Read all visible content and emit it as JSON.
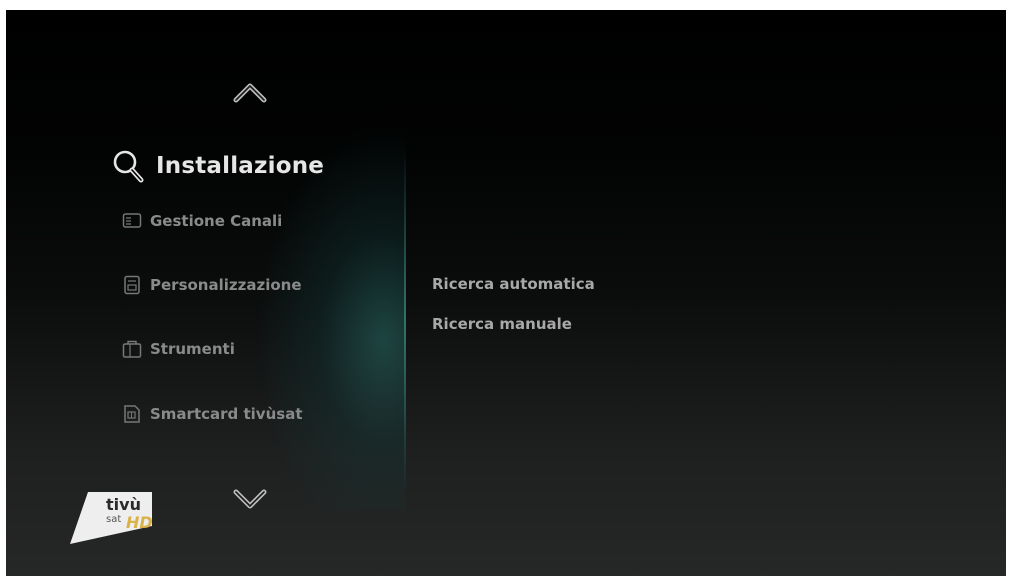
{
  "menu": {
    "section_title": "Installazione",
    "section_icon": "magnifier-icon",
    "items": [
      {
        "label": "Gestione Canali",
        "icon": "channel-list-icon"
      },
      {
        "label": "Personalizzazione",
        "icon": "customize-icon"
      },
      {
        "label": "Strumenti",
        "icon": "tools-icon"
      },
      {
        "label": "Smartcard tivùsat",
        "icon": "smartcard-icon"
      }
    ]
  },
  "submenu": {
    "items": [
      {
        "label": "Ricerca automatica"
      },
      {
        "label": "Ricerca manuale"
      }
    ]
  },
  "logo": {
    "brand": "tivù",
    "sub": "sat",
    "badge": "HD"
  },
  "colors": {
    "background_top": "#000000",
    "background_bottom": "#262727",
    "accent_teal": "#3c8c87",
    "text_active": "#e6e6e6",
    "text_inactive": "#8a8a8a",
    "logo_badge": "#d9b24a"
  }
}
